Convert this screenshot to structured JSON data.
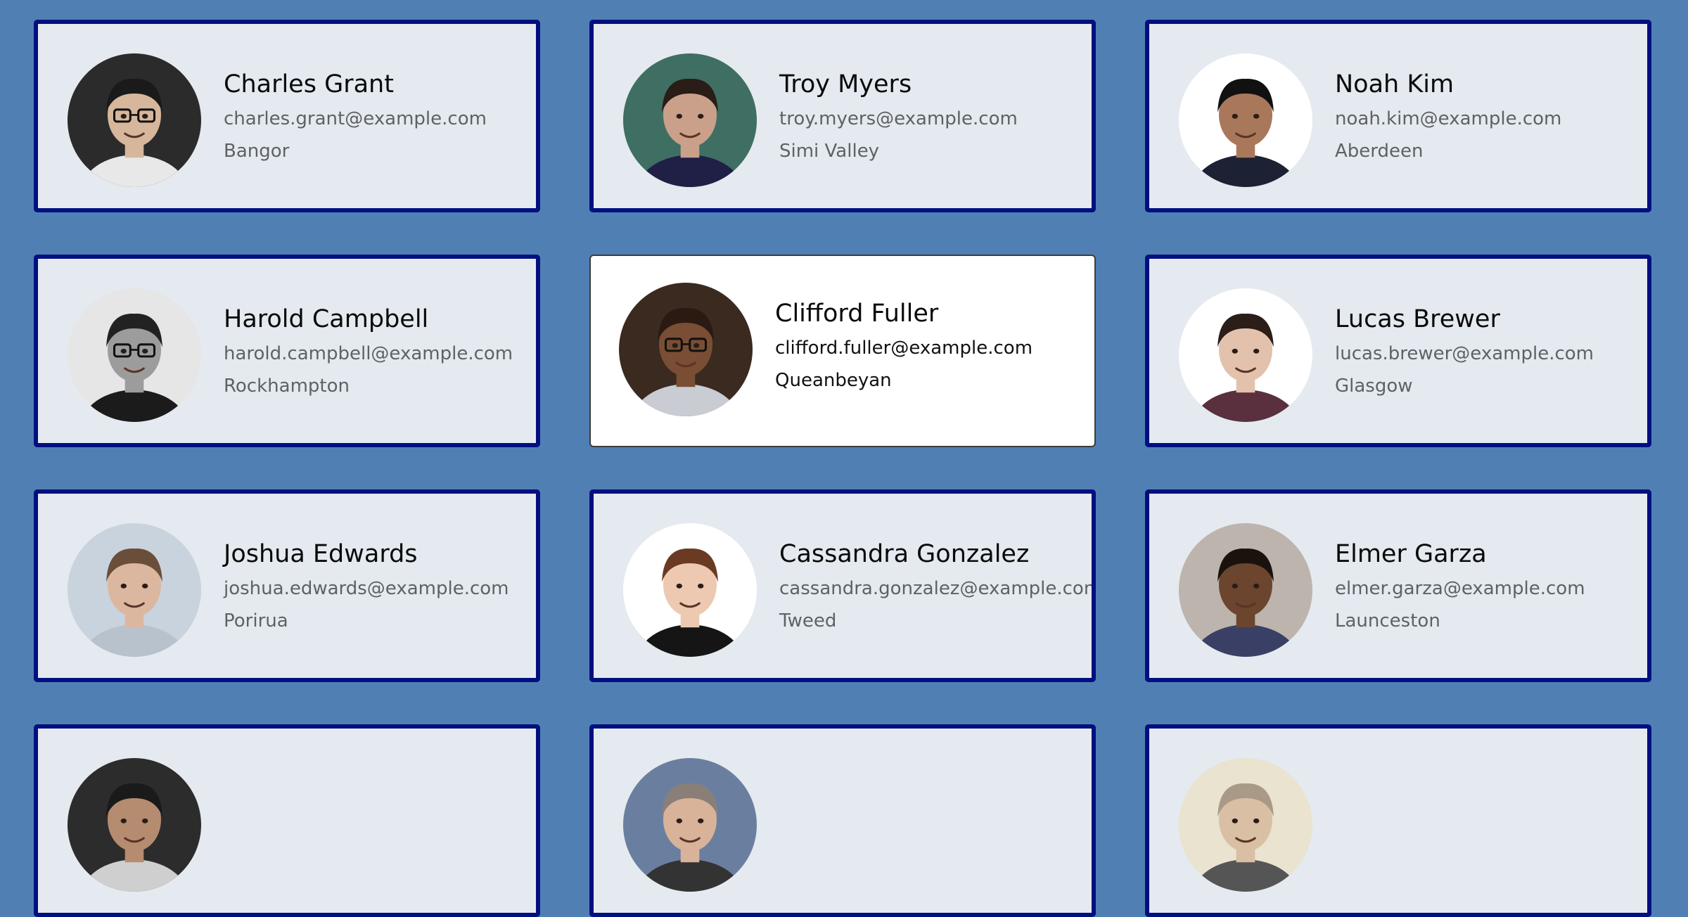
{
  "colors": {
    "background": "#5080b3",
    "card_background": "#e4eaef",
    "card_border": "#020f80",
    "active_card_background": "#ffffff",
    "active_card_border": "#3c3c3c"
  },
  "active_index": 4,
  "contacts": [
    {
      "name": "Charles Grant",
      "email": "charles.grant@example.com",
      "city": "Bangor",
      "avatar": {
        "bg": "#2b2b2b",
        "skin": "#d6b79c",
        "hair": "#1a1a1a",
        "shirt": "#e8e8e8",
        "glasses": true
      }
    },
    {
      "name": "Troy Myers",
      "email": "troy.myers@example.com",
      "city": "Simi Valley",
      "avatar": {
        "bg": "#3f6e63",
        "skin": "#caa08a",
        "hair": "#2a1c16",
        "shirt": "#202046",
        "glasses": false
      }
    },
    {
      "name": "Noah Kim",
      "email": "noah.kim@example.com",
      "city": "Aberdeen",
      "avatar": {
        "bg": "#ffffff",
        "skin": "#a9785a",
        "hair": "#111111",
        "shirt": "#1c2233",
        "glasses": false
      }
    },
    {
      "name": "Harold Campbell",
      "email": "harold.campbell@example.com",
      "city": "Rockhampton",
      "avatar": {
        "bg": "#e6e6e6",
        "skin": "#9c9c9c",
        "hair": "#222222",
        "shirt": "#1b1b1b",
        "glasses": true
      }
    },
    {
      "name": "Clifford Fuller",
      "email": "clifford.fuller@example.com",
      "city": "Queanbeyan",
      "avatar": {
        "bg": "#3b2a20",
        "skin": "#7a4e34",
        "hair": "#2a1a12",
        "shirt": "#c9ccd2",
        "glasses": true
      }
    },
    {
      "name": "Lucas Brewer",
      "email": "lucas.brewer@example.com",
      "city": "Glasgow",
      "avatar": {
        "bg": "#ffffff",
        "skin": "#e2c2ad",
        "hair": "#2b1d18",
        "shirt": "#5a2f3e",
        "glasses": false
      }
    },
    {
      "name": "Joshua Edwards",
      "email": "joshua.edwards@example.com",
      "city": "Porirua",
      "avatar": {
        "bg": "#c9d3dd",
        "skin": "#dcb79f",
        "hair": "#6a4e3a",
        "shirt": "#b8c2cc",
        "glasses": false
      }
    },
    {
      "name": "Cassandra Gonzalez",
      "email": "cassandra.gonzalez@example.com",
      "city": "Tweed",
      "avatar": {
        "bg": "#ffffff",
        "skin": "#edc9b2",
        "hair": "#6b3a22",
        "shirt": "#151515",
        "glasses": false
      }
    },
    {
      "name": "Elmer Garza",
      "email": "elmer.garza@example.com",
      "city": "Launceston",
      "avatar": {
        "bg": "#bcb4ad",
        "skin": "#6b452e",
        "hair": "#1a120d",
        "shirt": "#3a3f66",
        "glasses": false
      }
    },
    {
      "name": "",
      "email": "",
      "city": "",
      "avatar": {
        "bg": "#2c2c2c",
        "skin": "#b58c70",
        "hair": "#1a1a1a",
        "shirt": "#cfcfcf",
        "glasses": false
      }
    },
    {
      "name": "",
      "email": "",
      "city": "",
      "avatar": {
        "bg": "#6a7fa0",
        "skin": "#d8b299",
        "hair": "#8a7f77",
        "shirt": "#333333",
        "glasses": false
      }
    },
    {
      "name": "",
      "email": "",
      "city": "",
      "avatar": {
        "bg": "#e9e3cf",
        "skin": "#d9bfa3",
        "hair": "#a89a86",
        "shirt": "#555555",
        "glasses": false
      }
    }
  ]
}
